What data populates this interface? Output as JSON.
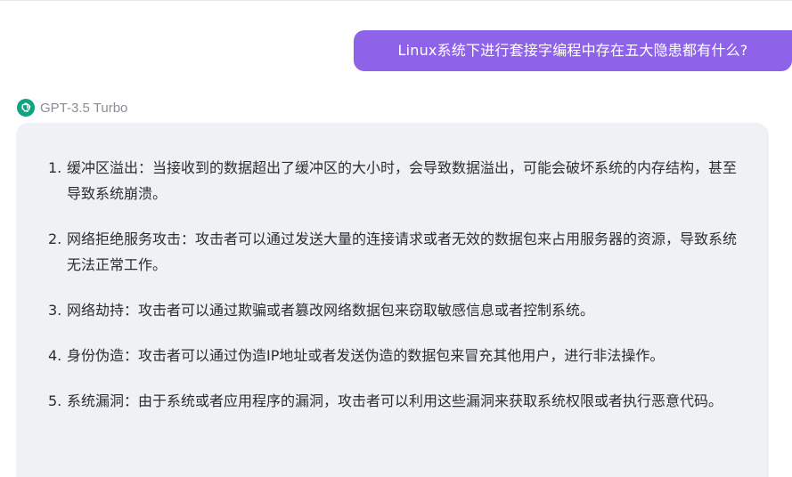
{
  "conversation": {
    "user_message": "Linux系统下进行套接字编程中存在五大隐患都有什么?",
    "assistant": {
      "model_name": "GPT-3.5 Turbo",
      "model_icon": "openai-logo-icon",
      "model_icon_color": "#10a37f",
      "items": [
        {
          "num": "1.",
          "text": "缓冲区溢出：当接收到的数据超出了缓冲区的大小时，会导致数据溢出，可能会破坏系统的内存结构，甚至导致系统崩溃。"
        },
        {
          "num": "2.",
          "text": "网络拒绝服务攻击：攻击者可以通过发送大量的连接请求或者无效的数据包来占用服务器的资源，导致系统无法正常工作。"
        },
        {
          "num": "3.",
          "text": "网络劫持：攻击者可以通过欺骗或者篡改网络数据包来窃取敏感信息或者控制系统。"
        },
        {
          "num": "4.",
          "text": "身份伪造：攻击者可以通过伪造IP地址或者发送伪造的数据包来冒充其他用户，进行非法操作。"
        },
        {
          "num": "5.",
          "text": "系统漏洞：由于系统或者应用程序的漏洞，攻击者可以利用这些漏洞来获取系统权限或者执行恶意代码。"
        }
      ]
    }
  },
  "colors": {
    "user_bubble": "#8e63ea",
    "card_background": "#f0f1f4",
    "model_name_text": "#8a8d93",
    "body_text": "#2b2d33"
  }
}
